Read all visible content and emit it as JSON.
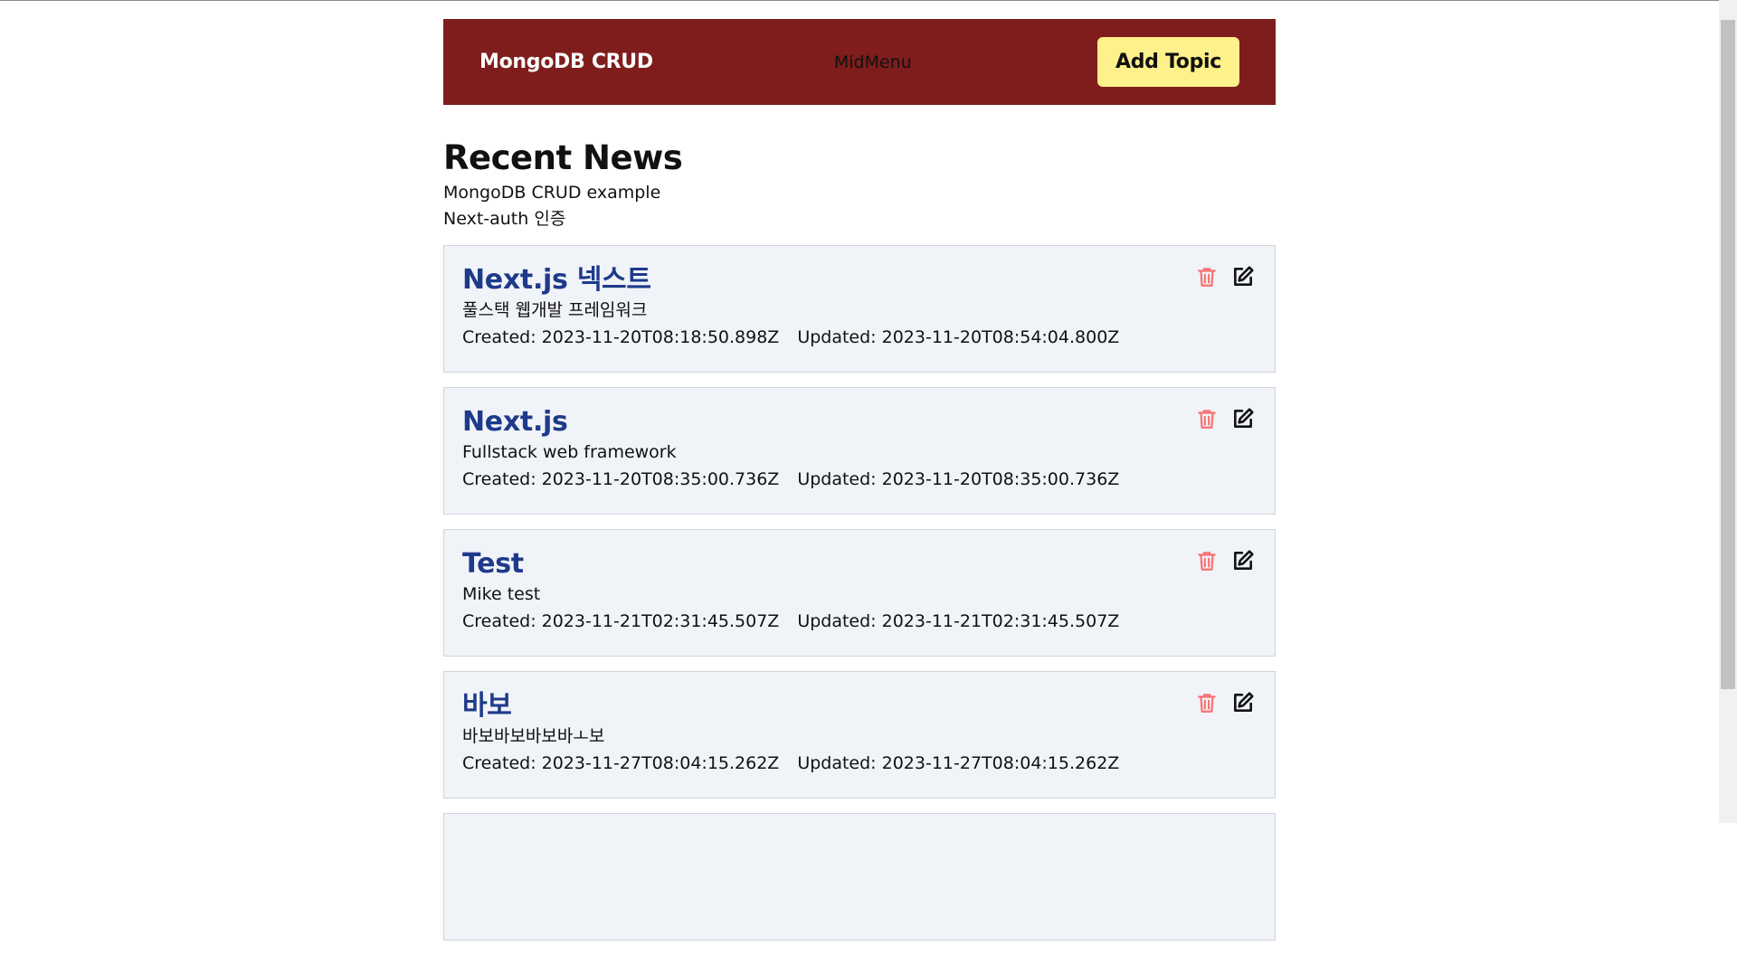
{
  "navbar": {
    "brand": "MongoDB CRUD",
    "mid_menu": "MidMenu",
    "add_button": "Add Topic"
  },
  "main": {
    "heading": "Recent News",
    "sublines": [
      "MongoDB CRUD example",
      "Next-auth 인증"
    ]
  },
  "topics": [
    {
      "title": "Next.js 넥스트",
      "description": "풀스택 웹개발 프레임워크",
      "created": "Created: 2023-11-20T08:18:50.898Z",
      "updated": "Updated: 2023-11-20T08:54:04.800Z"
    },
    {
      "title": "Next.js",
      "description": "Fullstack web framework",
      "created": "Created: 2023-11-20T08:35:00.736Z",
      "updated": "Updated: 2023-11-20T08:35:00.736Z"
    },
    {
      "title": "Test",
      "description": "Mike test",
      "created": "Created: 2023-11-21T02:31:45.507Z",
      "updated": "Updated: 2023-11-21T02:31:45.507Z"
    },
    {
      "title": "바보",
      "description": "바보바보바보바ㅗ보",
      "created": "Created: 2023-11-27T08:04:15.262Z",
      "updated": "Updated: 2023-11-27T08:04:15.262Z"
    }
  ],
  "colors": {
    "navbar_bg": "#7f1d1d",
    "add_button_bg": "#fef08a",
    "topic_title": "#1e3a8a",
    "delete_icon": "#f87171"
  },
  "icons": {
    "delete": "trash-icon",
    "edit": "edit-icon"
  }
}
